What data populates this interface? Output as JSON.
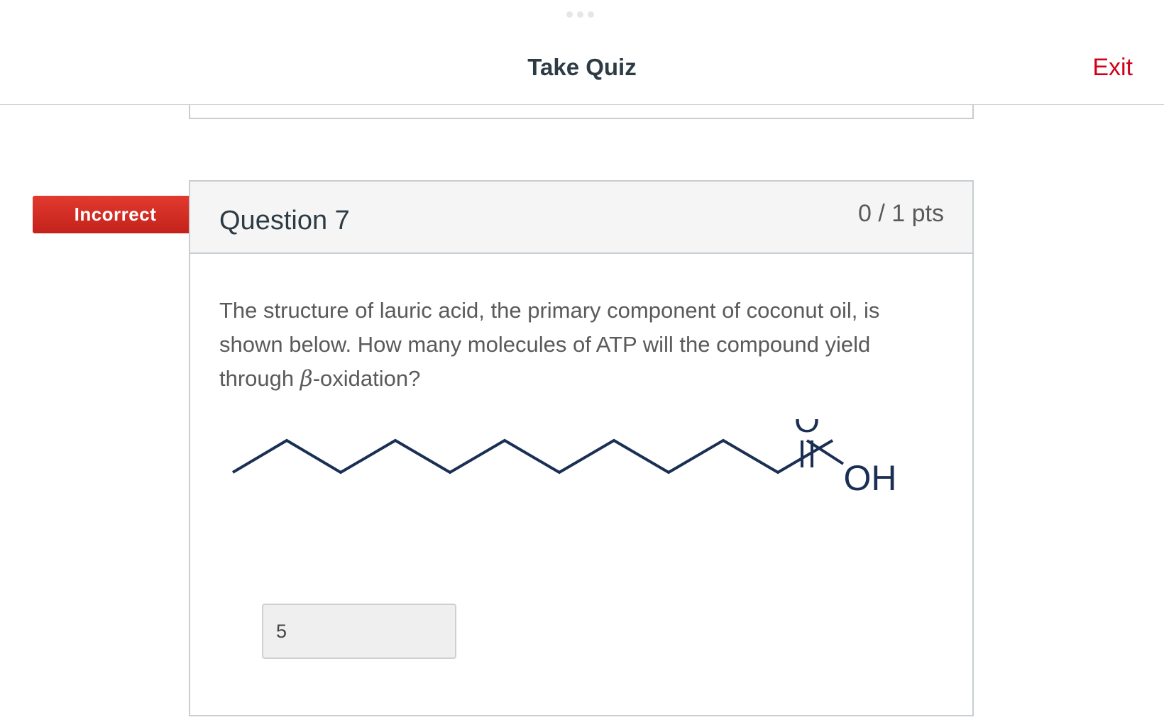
{
  "header": {
    "title": "Take Quiz",
    "exit_label": "Exit"
  },
  "question": {
    "status": "Incorrect",
    "title": "Question 7",
    "points": "0 / 1 pts",
    "text_before_symbol": "The structure of lauric acid, the primary component of coconut oil, is shown below. How many molecules of ATP will the compound yield through ",
    "symbol": "β",
    "text_after_symbol": "-oxidation?",
    "structure": {
      "carbonyl_oxygen_label": "O",
      "hydroxyl_label": "OH"
    },
    "answer_value": "5"
  },
  "colors": {
    "incorrect_flag": "#d12d24",
    "exit_link": "#d0021b",
    "bond": "#1b2f55"
  },
  "icons": {
    "drag_handle": "three-dots-icon"
  }
}
